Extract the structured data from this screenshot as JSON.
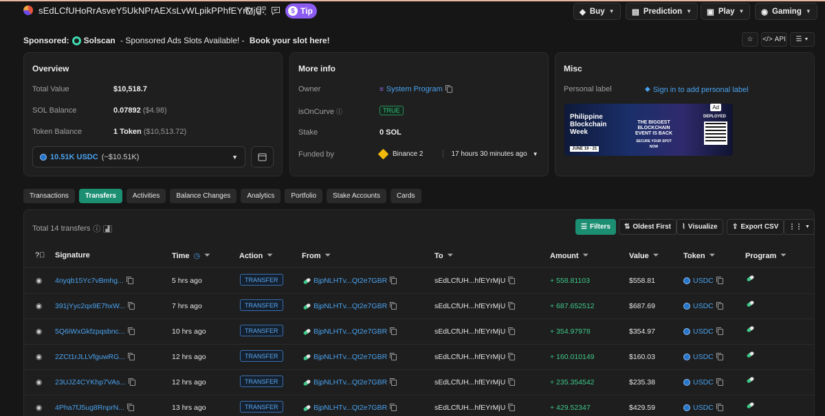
{
  "header": {
    "address": "sEdLCfUHoRrAsveY5UkNPrAEXsLvWLpikPPhfEYrMjU",
    "tip_label": "Tip",
    "nav": [
      {
        "label": "Buy",
        "icon": "tag-icon"
      },
      {
        "label": "Prediction",
        "icon": "chart-icon"
      },
      {
        "label": "Play",
        "icon": "screen-icon"
      },
      {
        "label": "Gaming",
        "icon": "gamepad-icon"
      }
    ]
  },
  "sponsored": {
    "prefix": "Sponsored:",
    "brand": "Solscan",
    "text": " - Sponsored Ads Slots Available! - ",
    "cta": "Book your slot here!",
    "api_label": "API"
  },
  "overview": {
    "title": "Overview",
    "total_value_label": "Total Value",
    "total_value": "$10,518.7",
    "sol_balance_label": "SOL Balance",
    "sol_balance": "0.07892",
    "sol_balance_usd": "($4.98)",
    "token_balance_label": "Token Balance",
    "token_balance": "1 Token",
    "token_balance_usd": "($10,513.72)",
    "selected_token": "10.51K USDC",
    "selected_token_usd": "(~$10.51K)"
  },
  "more_info": {
    "title": "More info",
    "owner_label": "Owner",
    "owner_value": "System Program",
    "is_on_curve_label": "isOnCurve",
    "is_on_curve_value": "TRUE",
    "stake_label": "Stake",
    "stake_value": "0 SOL",
    "funded_by_label": "Funded by",
    "funded_by_value": "Binance 2",
    "funded_time": "17 hours 30 minutes ago"
  },
  "misc": {
    "title": "Misc",
    "personal_label": "Personal label",
    "sign_in_text": "Sign in to add personal label",
    "ad": {
      "tag": "Ad",
      "headline": "Philippine Blockchain Week",
      "center": "THE BIGGEST BLOCKCHAIN EVENT IS BACK",
      "sub": "SECURE YOUR SPOT NOW",
      "dates": "JUNE 19 - 21",
      "brand": "DEPLOYED"
    }
  },
  "tabs": [
    "Transactions",
    "Transfers",
    "Activities",
    "Balance Changes",
    "Analytics",
    "Portfolio",
    "Stake Accounts",
    "Cards"
  ],
  "active_tab": "Transfers",
  "table": {
    "total_text": "Total 14 transfers",
    "filters_label": "Filters",
    "oldest_first_label": "Oldest First",
    "visualize_label": "Visualize",
    "export_label": "Export CSV",
    "columns": [
      "Signature",
      "Time",
      "Action",
      "From",
      "To",
      "Amount",
      "Value",
      "Token",
      "Program"
    ],
    "rows": [
      {
        "signature": "4nyqb15Yc7vBmhg...",
        "time": "5 hrs ago",
        "action": "TRANSFER",
        "from": "BjpNLHTv...Qt2e7GBR",
        "to": "sEdLCfUH...hfEYrMjU",
        "amount": "+ 558.81103",
        "value": "$558.81",
        "token": "USDC"
      },
      {
        "signature": "391jYyc2qx9E7hxW...",
        "time": "7 hrs ago",
        "action": "TRANSFER",
        "from": "BjpNLHTv...Qt2e7GBR",
        "to": "sEdLCfUH...hfEYrMjU",
        "amount": "+ 687.652512",
        "value": "$687.69",
        "token": "USDC"
      },
      {
        "signature": "5Q6iWxGkfzpqsbnc...",
        "time": "10 hrs ago",
        "action": "TRANSFER",
        "from": "BjpNLHTv...Qt2e7GBR",
        "to": "sEdLCfUH...hfEYrMjU",
        "amount": "+ 354.97978",
        "value": "$354.97",
        "token": "USDC"
      },
      {
        "signature": "2ZCt1rJLLVfguwRG...",
        "time": "12 hrs ago",
        "action": "TRANSFER",
        "from": "BjpNLHTv...Qt2e7GBR",
        "to": "sEdLCfUH...hfEYrMjU",
        "amount": "+ 160.010149",
        "value": "$160.03",
        "token": "USDC"
      },
      {
        "signature": "23UJZ4CYKhp7VAs...",
        "time": "12 hrs ago",
        "action": "TRANSFER",
        "from": "BjpNLHTv...Qt2e7GBR",
        "to": "sEdLCfUH...hfEYrMjU",
        "amount": "+ 235.354542",
        "value": "$235.38",
        "token": "USDC"
      },
      {
        "signature": "4Pha7fJ5ug8RnprN...",
        "time": "13 hrs ago",
        "action": "TRANSFER",
        "from": "BjpNLHTv...Qt2e7GBR",
        "to": "sEdLCfUH...hfEYrMjU",
        "amount": "+ 429.52347",
        "value": "$429.59",
        "token": "USDC"
      }
    ]
  },
  "colors": {
    "accent": "#1c8f73",
    "link": "#4aa3f0",
    "positive": "#3ec98a",
    "tip": "#8c5cf0"
  }
}
